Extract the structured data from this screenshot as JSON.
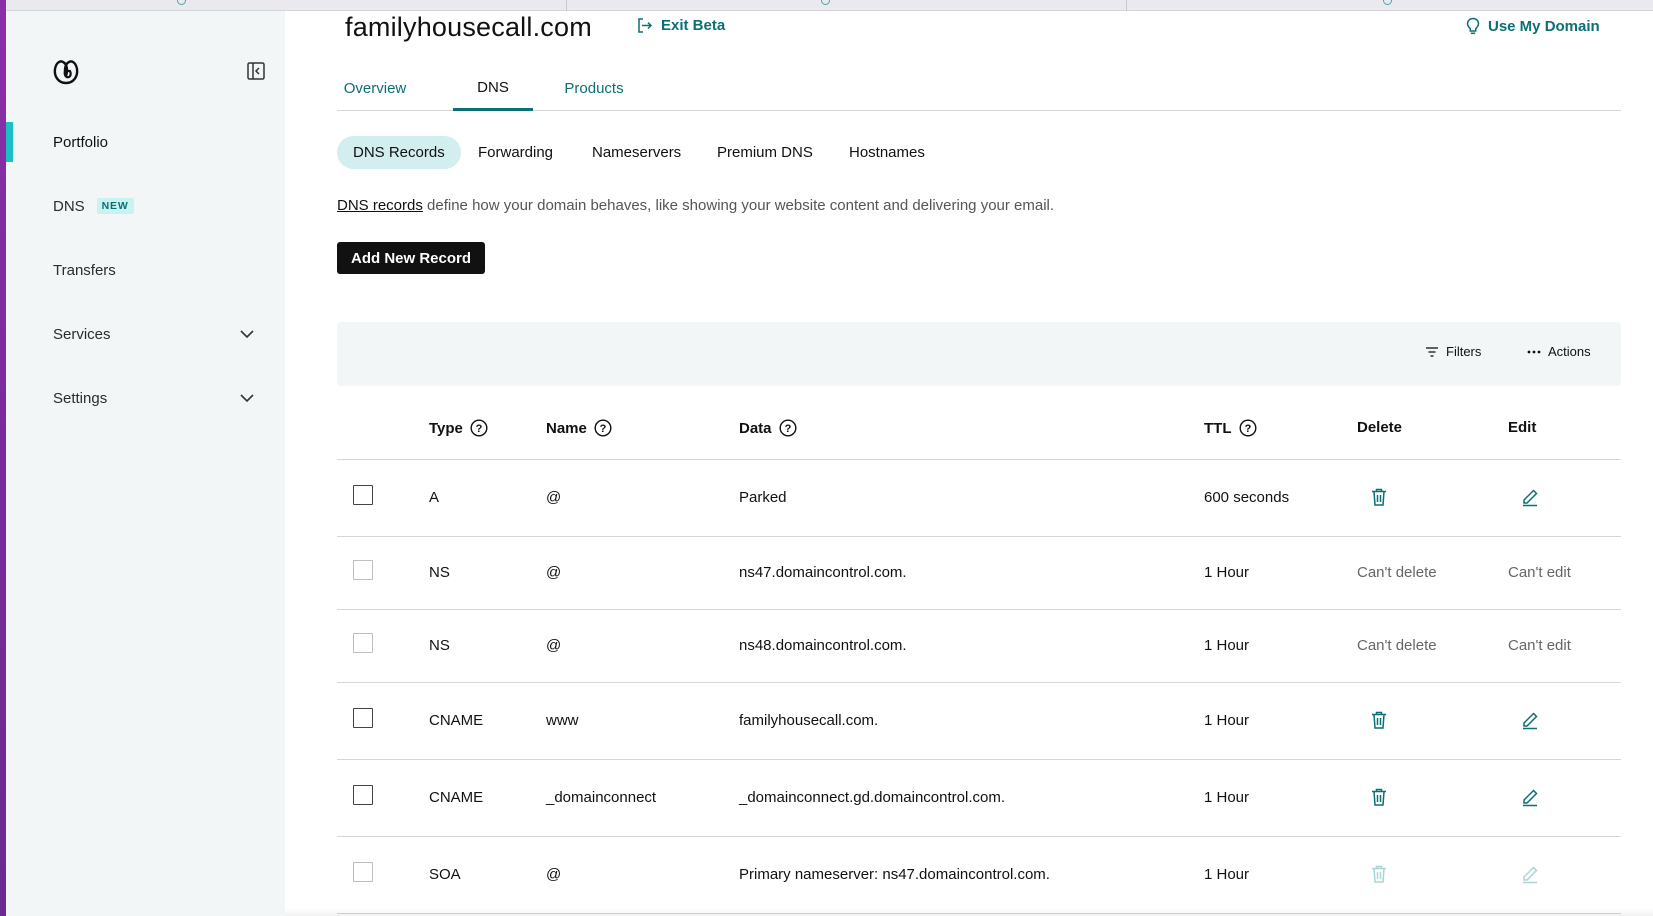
{
  "header": {
    "domain": "familyhousecall.com",
    "exit_beta": "Exit Beta",
    "use_my_domain": "Use My Domain"
  },
  "sidebar": {
    "items": [
      {
        "label": "Portfolio",
        "active": true
      },
      {
        "label": "DNS",
        "badge": "NEW"
      },
      {
        "label": "Transfers"
      },
      {
        "label": "Services",
        "expandable": true
      },
      {
        "label": "Settings",
        "expandable": true
      }
    ]
  },
  "main_tabs": [
    "Overview",
    "DNS",
    "Products"
  ],
  "active_main_tab": "DNS",
  "sub_tabs": [
    "DNS Records",
    "Forwarding",
    "Nameservers",
    "Premium DNS",
    "Hostnames"
  ],
  "active_sub_tab": "DNS Records",
  "description": {
    "link": "DNS records",
    "text": " define how your domain behaves, like showing your website content and delivering your email."
  },
  "add_button": "Add New Record",
  "toolbar": {
    "filters": "Filters",
    "actions": "Actions"
  },
  "table": {
    "columns": [
      "Type",
      "Name",
      "Data",
      "TTL",
      "Delete",
      "Edit"
    ],
    "rows": [
      {
        "type": "A",
        "name": "@",
        "data": "Parked",
        "ttl": "600 seconds",
        "deletable": true,
        "editable": true
      },
      {
        "type": "NS",
        "name": "@",
        "data": "ns47.domaincontrol.com.",
        "ttl": "1 Hour",
        "delete_text": "Can't delete",
        "edit_text": "Can't edit"
      },
      {
        "type": "NS",
        "name": "@",
        "data": "ns48.domaincontrol.com.",
        "ttl": "1 Hour",
        "delete_text": "Can't delete",
        "edit_text": "Can't edit"
      },
      {
        "type": "CNAME",
        "name": "www",
        "data": "familyhousecall.com.",
        "ttl": "1 Hour",
        "deletable": true,
        "editable": true
      },
      {
        "type": "CNAME",
        "name": "_domainconnect",
        "data": "_domainconnect.gd.domaincontrol.com.",
        "ttl": "1 Hour",
        "deletable": true,
        "editable": true
      },
      {
        "type": "SOA",
        "name": "@",
        "data": "Primary nameserver: ns47.domaincontrol.com.",
        "ttl": "1 Hour",
        "icons_disabled": true
      }
    ]
  },
  "colors": {
    "brand_teal": "#0b6f74",
    "active_indicator": "#1bbfc4",
    "sidebar_bg": "#f3f6f7",
    "subtab_active_bg": "#d3eeef",
    "badge_bg": "#c9f3f1",
    "primary_button": "#111111"
  },
  "icons": {
    "logo": "godaddy-logo-icon",
    "collapse": "sidebar-collapse-icon",
    "exit": "exit-icon",
    "bulb": "lightbulb-icon",
    "chevron": "chevron-down-icon",
    "filter": "filter-icon",
    "more": "ellipsis-icon",
    "help": "help-circle-icon",
    "delete": "trash-icon",
    "edit": "pencil-icon"
  }
}
